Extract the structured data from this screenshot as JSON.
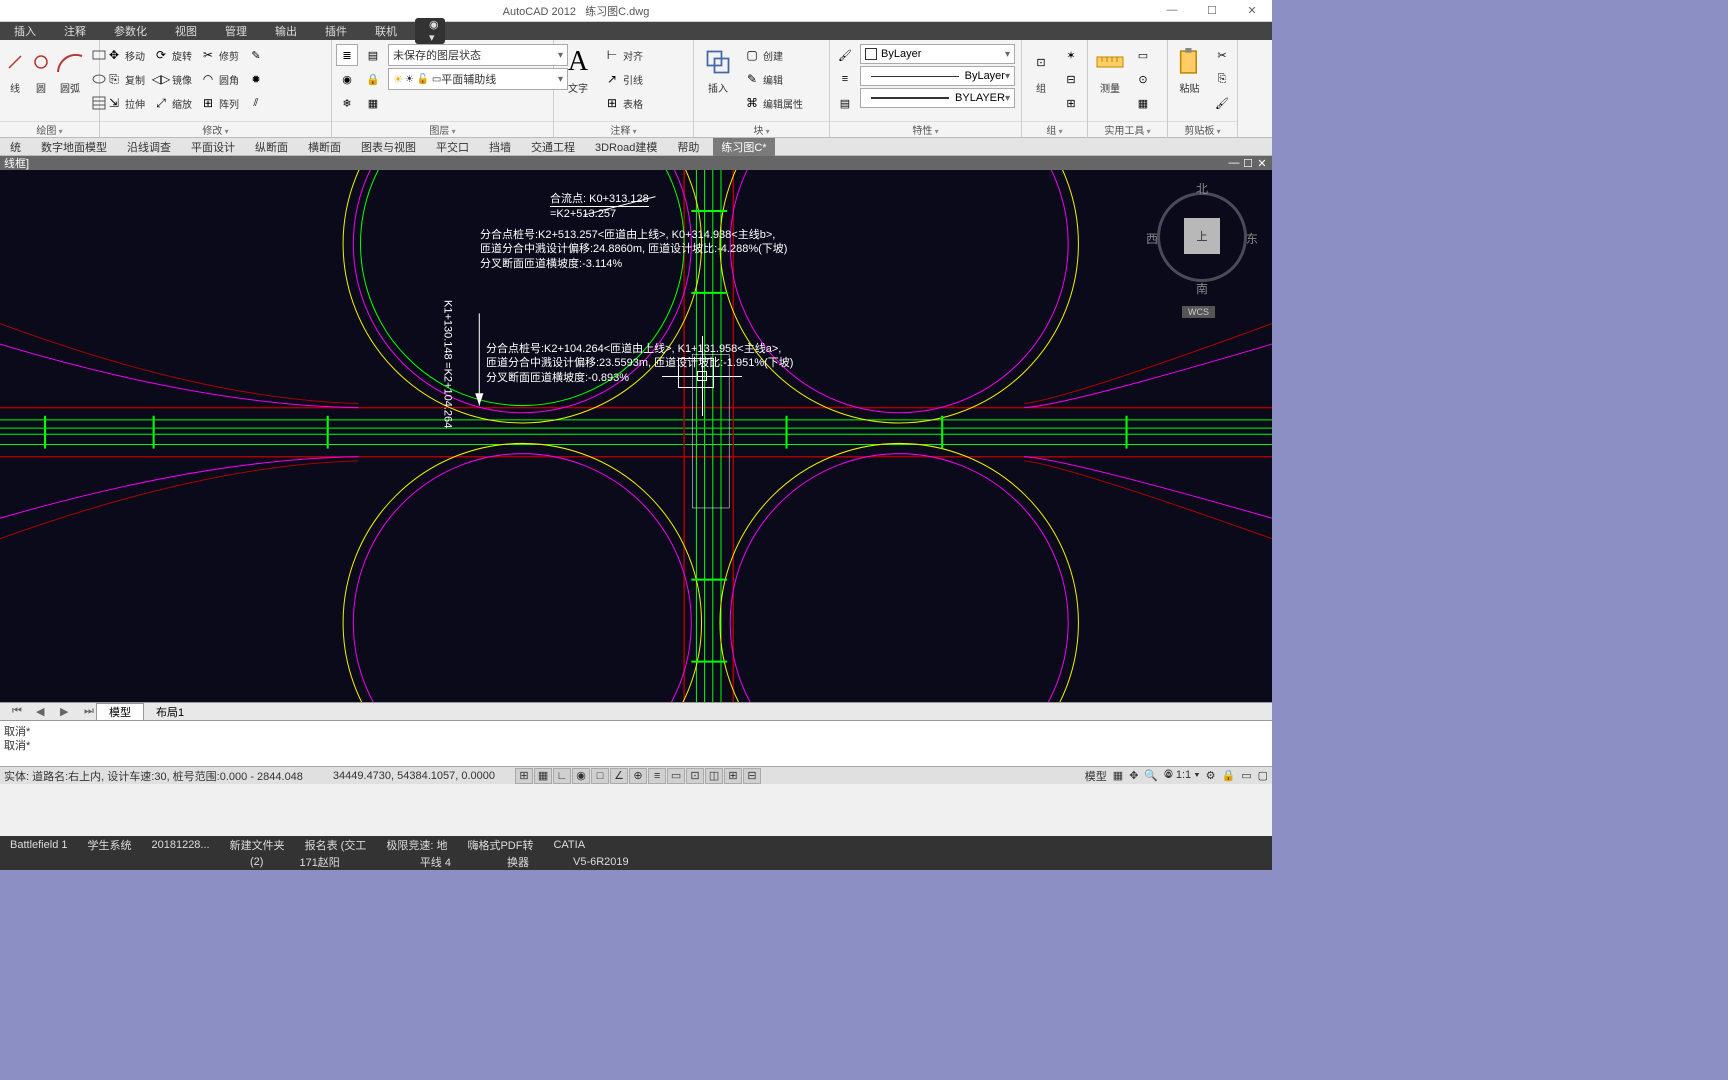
{
  "window": {
    "app_title": "AutoCAD 2012",
    "doc_title": "练习图C.dwg",
    "min": "—",
    "max": "☐",
    "close": "✕"
  },
  "menutabs": [
    "插入",
    "注释",
    "参数化",
    "视图",
    "管理",
    "输出",
    "插件",
    "联机"
  ],
  "ribbon": {
    "draw": {
      "title": "绘图",
      "items": [
        "线",
        "圆",
        "圆弧"
      ]
    },
    "modify": {
      "title": "修改",
      "items": [
        "移动",
        "复制",
        "拉伸",
        "旋转",
        "镜像",
        "缩放",
        "修剪",
        "圆角",
        "阵列"
      ]
    },
    "layer": {
      "title": "图层",
      "state": "未保存的图层状态",
      "current": "平面辅助线"
    },
    "annotation": {
      "title": "注释",
      "text": "文字",
      "items": [
        "对齐",
        "引线",
        "表格"
      ]
    },
    "block": {
      "title": "块",
      "insert": "插入",
      "items": [
        "创建",
        "编辑",
        "编辑属性"
      ]
    },
    "properties": {
      "title": "特性",
      "color": "ByLayer",
      "ltype": "ByLayer",
      "lweight": "BYLAYER"
    },
    "group": {
      "title": "组",
      "label": "组"
    },
    "util": {
      "title": "实用工具",
      "measure": "测量"
    },
    "clip": {
      "title": "剪贴板",
      "paste": "粘贴"
    }
  },
  "secmenu": [
    "统",
    "数字地面模型",
    "沿线调查",
    "平面设计",
    "纵断面",
    "横断面",
    "图表与视图",
    "平交口",
    "挡墙",
    "交通工程",
    "3DRoad建模",
    "帮助"
  ],
  "doc_tab": "练习图C*",
  "drawheader_title": "线框]",
  "viewcube": {
    "top": "上",
    "n": "北",
    "s": "南",
    "w": "西",
    "e": "东",
    "wcs": "WCS"
  },
  "annotations": {
    "a1_l1": "合流点: K0+313.128",
    "a1_l2": "=K2+513.257",
    "a2_l1": "分合点桩号:K2+513.257<匝道由上线>, K0+314.938<主线b>,",
    "a2_l2": "匝道分合中溅设计偏移:24.8860m, 匝道设计坡比:-4.288%(下坡)",
    "a2_l3": "分叉断面匝道横坡度:-3.114%",
    "a3_l1": "分合点桩号:K2+104.264<匝道由上线>, K1+131.958<主线a>,",
    "a3_l2": "匝道分合中溅设计偏移:23.5593m, 匝道设计坡比:-1.951%(下坡)",
    "a3_l3": "分叉断面匝道横坡度:-0.893%",
    "a4_l1": "K1+130.148",
    "a4_l2": "=K2+104.264"
  },
  "modeltabs": {
    "model": "模型",
    "layout": "布局1"
  },
  "cmd": {
    "line1": "取消*",
    "line2": "取消*"
  },
  "statusbar": {
    "left": "实体: 道路名:右上内, 设计车速:30, 桩号范围:0.000 - 2844.048",
    "coords": "34449.4730, 54384.1057, 0.0000",
    "model": "模型",
    "scale": "1:1"
  },
  "taskbar": [
    "Battlefield 1",
    "学生系统",
    "20181228...",
    "新建文件夹",
    "报名表 (交工",
    "极限竞速: 地",
    "嗨格式PDF转",
    "CATIA"
  ],
  "taskbar2": [
    "(2)",
    "171赵阳",
    "平线 4",
    "换器",
    "V5-6R2019"
  ]
}
